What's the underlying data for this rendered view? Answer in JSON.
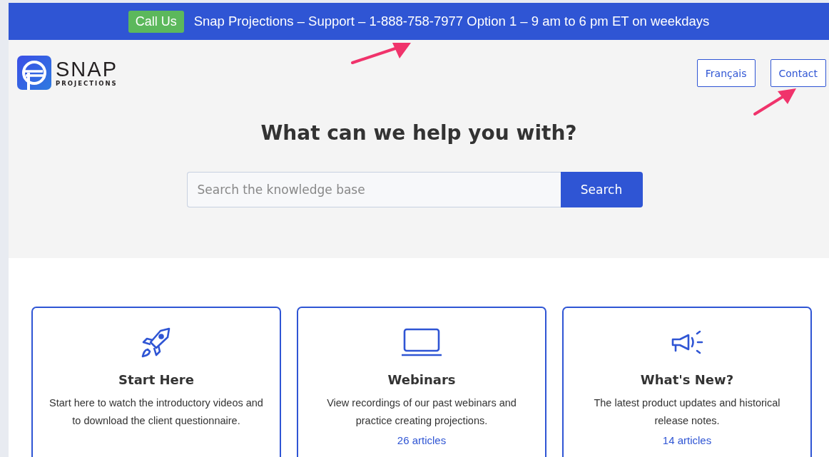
{
  "top_bar": {
    "badge": "Call Us",
    "text": "Snap Projections – Support – 1-888-758-7977 Option 1 – 9 am to 6 pm ET on weekdays"
  },
  "logo": {
    "name": "SNAP",
    "tagline": "PROJECTIONS"
  },
  "nav_buttons": [
    "Français",
    "Contact"
  ],
  "heading": "What can we help you with?",
  "search": {
    "placeholder": "Search the knowledge base",
    "button": "Search"
  },
  "cards": [
    {
      "kind": "rocket",
      "title": "Start Here",
      "description": "Start here to watch the introductory videos and to download the client questionnaire."
    },
    {
      "kind": "laptop",
      "title": "Webinars",
      "description": "View recordings of our past webinars and practice creating projections.",
      "articles": "26 articles"
    },
    {
      "kind": "megaphone",
      "title": "What's New?",
      "description": "The latest product updates and historical release notes.",
      "articles": "14 articles"
    }
  ]
}
